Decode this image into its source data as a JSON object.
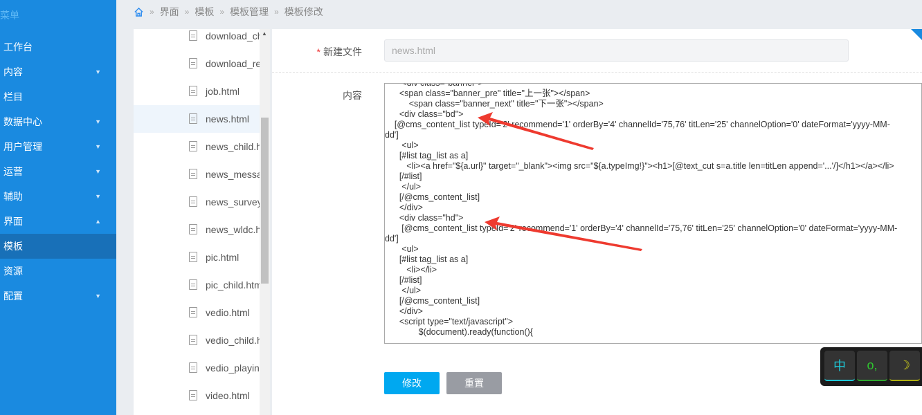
{
  "sidebar": {
    "title": "菜单",
    "items": [
      {
        "label": "工作台",
        "arrow": ""
      },
      {
        "label": "内容",
        "arrow": "▼"
      },
      {
        "label": "栏目",
        "arrow": ""
      },
      {
        "label": "数据中心",
        "arrow": "▼"
      },
      {
        "label": "用户管理",
        "arrow": "▼"
      },
      {
        "label": "运营",
        "arrow": "▼"
      },
      {
        "label": "辅助",
        "arrow": "▼"
      },
      {
        "label": "界面",
        "arrow": "▲"
      },
      {
        "label": "模板",
        "arrow": ""
      },
      {
        "label": "资源",
        "arrow": ""
      },
      {
        "label": "配置",
        "arrow": "▼"
      }
    ],
    "active": 8
  },
  "breadcrumb": [
    "界面",
    "模板",
    "模板管理",
    "模板修改"
  ],
  "files": [
    "download_ch",
    "download_re",
    "job.html",
    "news.html",
    "news_child.h",
    "news_messa",
    "news_survey",
    "news_wldc.h",
    "pic.html",
    "pic_child.htm",
    "vedio.html",
    "vedio_child.h",
    "vedio_playin",
    "video.html"
  ],
  "active_file": 3,
  "form": {
    "name_label": "新建文件",
    "name_value": "news.html",
    "content_label": "内容",
    "save": "修改",
    "reset": "重置"
  },
  "code": [
    "       <div class=\"banner\">",
    "      <span class=\"banner_pre\" title=\"上一张\"></span>",
    "          <span class=\"banner_next\" title=\"下一张\"></span>",
    "      <div class=\"bd\">",
    "    [@cms_content_list typeId='2' recommend='1' orderBy='4' channelId='75,76' titLen='25' channelOption='0' dateFormat='yyyy-MM-",
    "dd']",
    "       <ul>",
    "      [#list tag_list as a]",
    "         <li><a href=\"${a.url}\" target=\"_blank\"><img src=\"${a.typeImg!}\"><h1>[@text_cut s=a.title len=titLen append='...'/]</h1></a></li>",
    "      [/#list]",
    "       </ul>",
    "      [/@cms_content_list]",
    "      </div>",
    "      <div class=\"hd\">",
    "       [@cms_content_list typeId='2' recommend='1' orderBy='4' channelId='75,76' titLen='25' channelOption='0' dateFormat='yyyy-MM-",
    "dd']",
    "       <ul>",
    "      [#list tag_list as a]",
    "         <li></li>",
    "      [/#list]",
    "       </ul>",
    "      [/@cms_content_list]",
    "      </div>",
    "      <script type=\"text/javascript\">",
    "              $(document).ready(function(){"
  ],
  "ime": {
    "keys": [
      "中",
      "o,",
      "☽"
    ]
  }
}
